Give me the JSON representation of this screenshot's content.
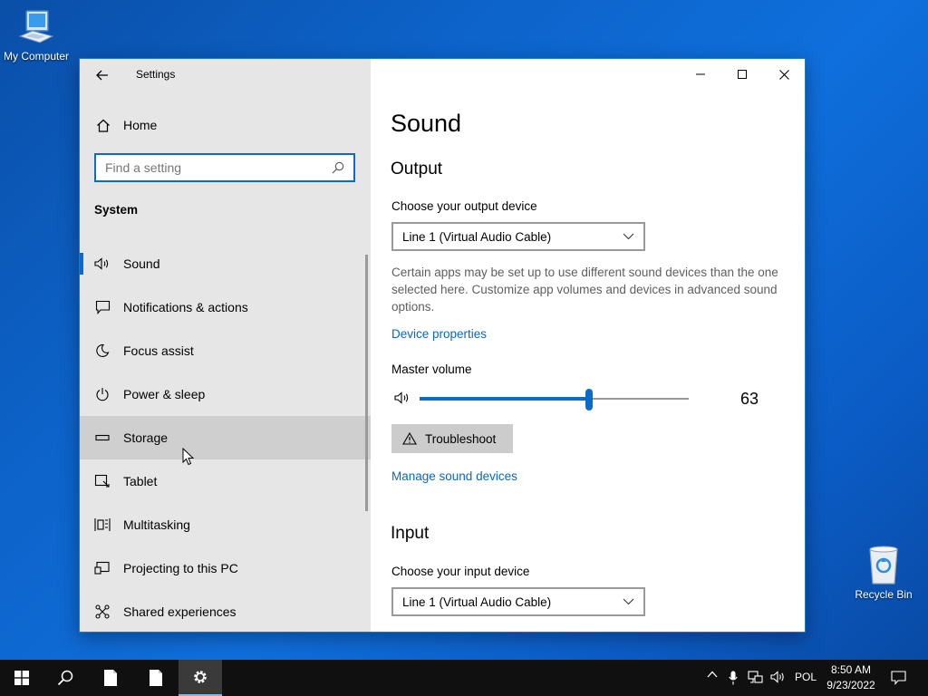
{
  "desktop": {
    "my_computer_label": "My Computer",
    "recycle_bin_label": "Recycle Bin"
  },
  "window": {
    "title": "Settings",
    "sidebar": {
      "home_label": "Home",
      "search_placeholder": "Find a setting",
      "section_title": "System",
      "items": [
        {
          "label": "Sound",
          "icon": "speaker-icon",
          "selected": true
        },
        {
          "label": "Notifications & actions",
          "icon": "notification-icon"
        },
        {
          "label": "Focus assist",
          "icon": "moon-icon"
        },
        {
          "label": "Power & sleep",
          "icon": "power-icon"
        },
        {
          "label": "Storage",
          "icon": "storage-icon",
          "hovered": true
        },
        {
          "label": "Tablet",
          "icon": "tablet-icon"
        },
        {
          "label": "Multitasking",
          "icon": "multitasking-icon"
        },
        {
          "label": "Projecting to this PC",
          "icon": "projecting-icon"
        },
        {
          "label": "Shared experiences",
          "icon": "shared-experiences-icon"
        }
      ]
    },
    "content": {
      "page_title": "Sound",
      "output": {
        "heading": "Output",
        "device_label": "Choose your output device",
        "device_value": "Line 1 (Virtual Audio Cable)",
        "description": "Certain apps may be set up to use different sound devices than the one selected here. Customize app volumes and devices in advanced sound options.",
        "device_properties_link": "Device properties",
        "master_volume_label": "Master volume",
        "volume_value": "63",
        "volume_fraction": 0.63,
        "troubleshoot_label": "Troubleshoot",
        "manage_link": "Manage sound devices"
      },
      "input": {
        "heading": "Input",
        "device_label": "Choose your input device",
        "device_value": "Line 1 (Virtual Audio Cable)"
      }
    }
  },
  "taskbar": {
    "language": "POL",
    "time": "8:50 AM",
    "date": "9/23/2022"
  },
  "colors": {
    "accent": "#0a6cc7",
    "link": "#0b68b8",
    "sidebar_bg": "#e6e6e6",
    "taskbar_bg": "#101010"
  }
}
